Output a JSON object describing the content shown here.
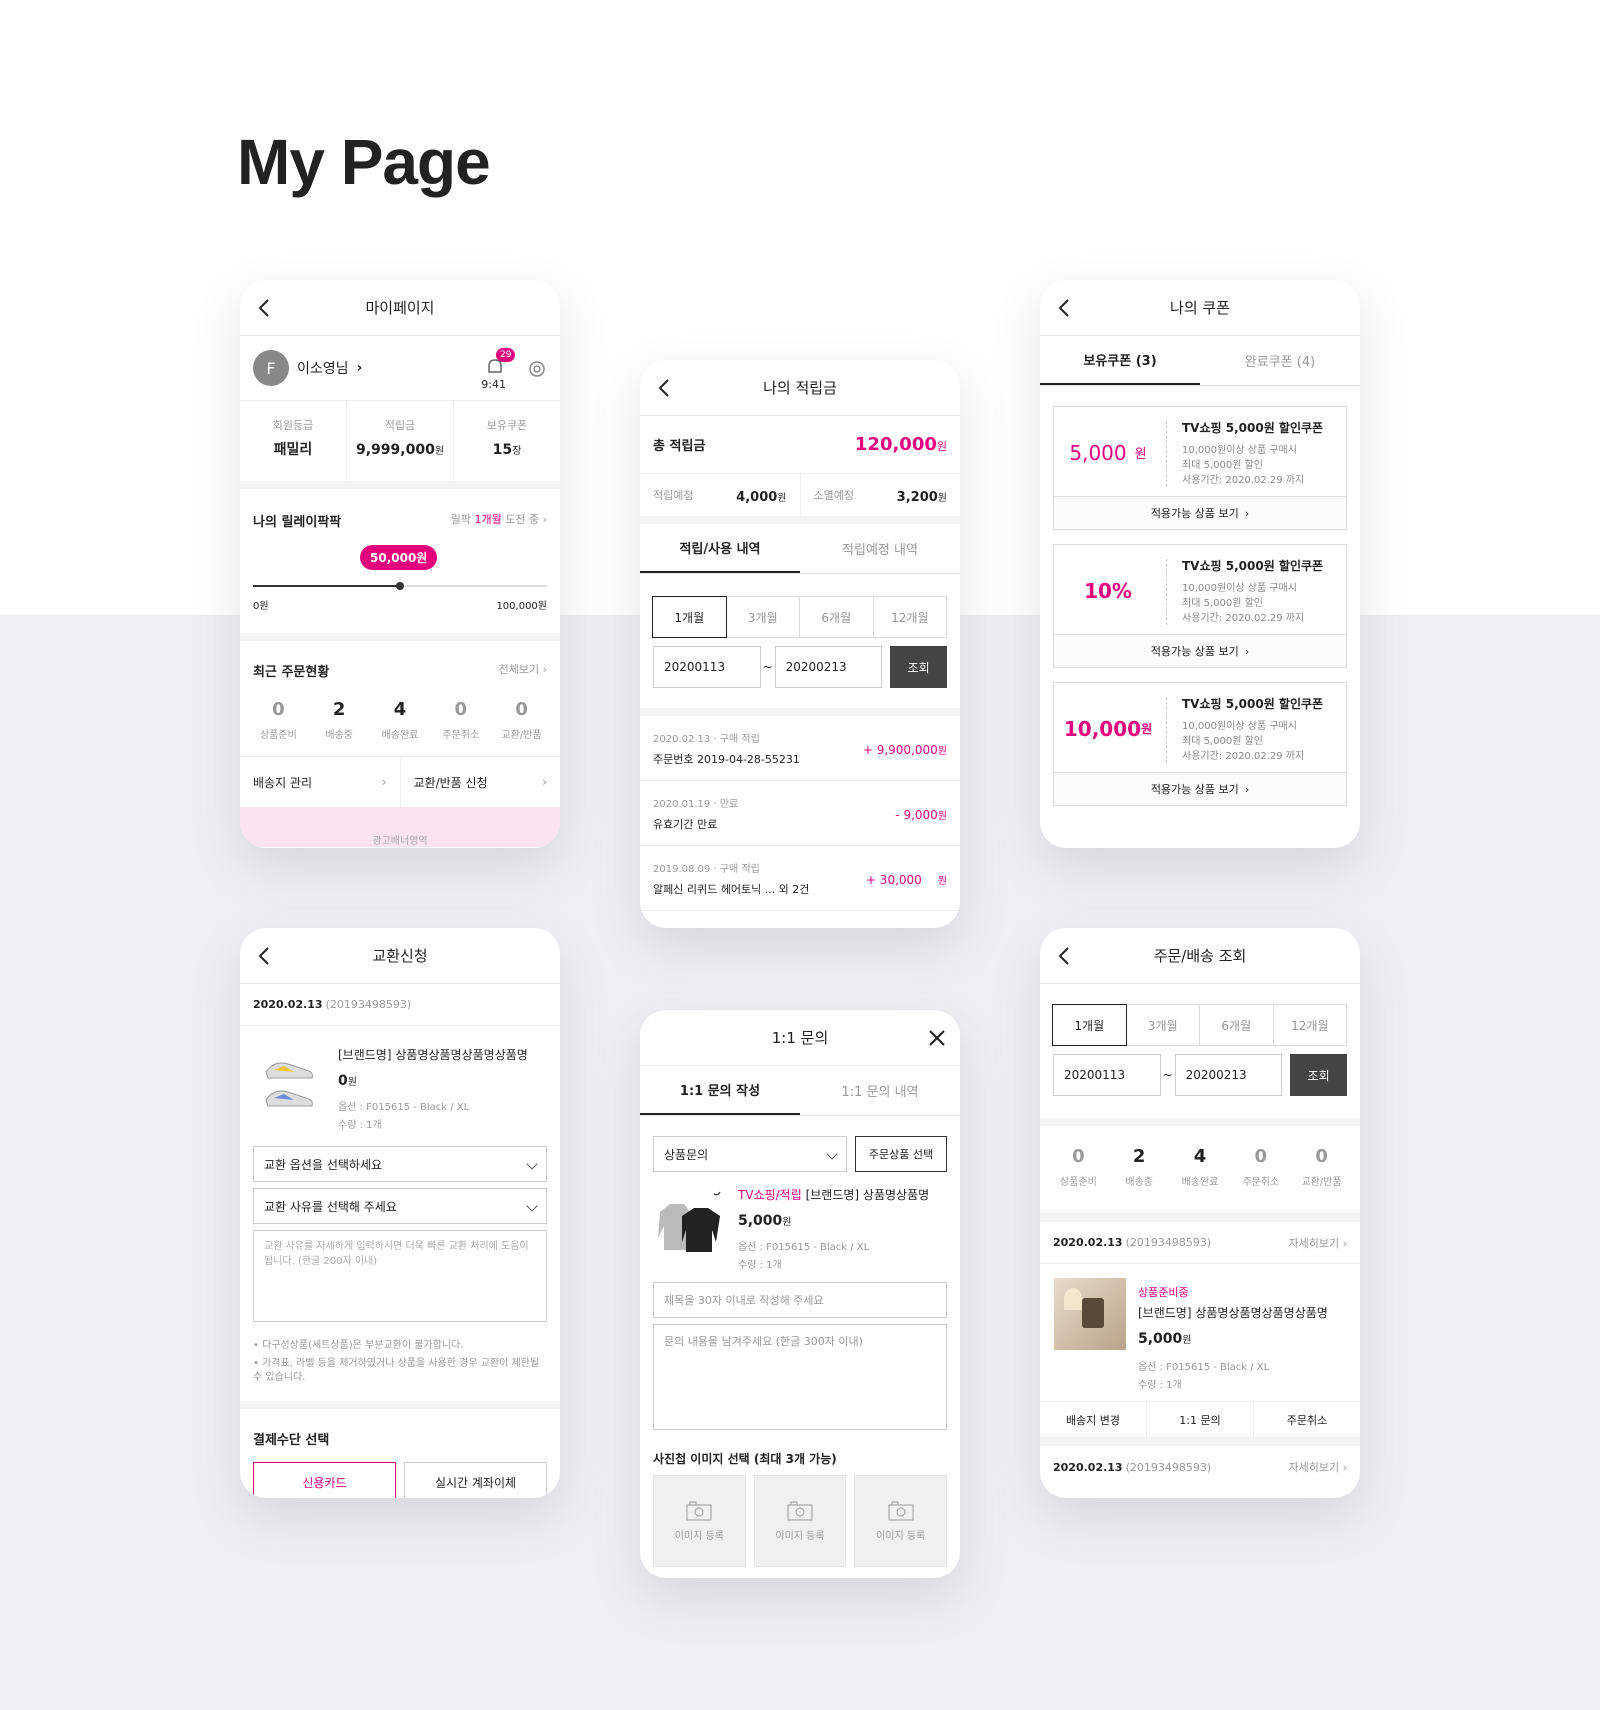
{
  "page_title": "My Page",
  "mypage": {
    "title": "마이페이지",
    "avatar": "F",
    "user": "이소영님",
    "notif_count": "29",
    "time": "9:41",
    "stats": [
      {
        "label": "회원등급",
        "value": "패밀리",
        "unit": ""
      },
      {
        "label": "적립금",
        "value": "9,999,000",
        "unit": "원"
      },
      {
        "label": "보유쿠폰",
        "value": "15",
        "unit": "장"
      }
    ],
    "relay_title": "나의 릴레이팍팍",
    "relay_pre": "릴팍",
    "relay_highlight": "1개월",
    "relay_post": "도전 중",
    "relay_badge": "50,000원",
    "relay_progress": 0.5,
    "relay_min": "0원",
    "relay_max": "100,000원",
    "orders_title": "최근 주문현황",
    "orders_all": "전체보기",
    "orders": [
      {
        "n": "0",
        "l": "상품준비"
      },
      {
        "n": "2",
        "l": "배송중"
      },
      {
        "n": "4",
        "l": "배송완료"
      },
      {
        "n": "0",
        "l": "주문취소"
      },
      {
        "n": "0",
        "l": "교환/반품"
      }
    ],
    "link1": "배송지 관리",
    "link2": "교환/반품 신청",
    "ad": "광고배너영역"
  },
  "points": {
    "title": "나의 적립금",
    "total_label": "총 적립금",
    "total_value": "120,000",
    "total_unit": "원",
    "planned_label": "적립예정",
    "planned_value": "4,000",
    "expire_label": "소멸예정",
    "expire_value": "3,200",
    "unit": "원",
    "tabs": [
      "적립/사용 내역",
      "적립예정 내역"
    ],
    "periods": [
      "1개월",
      "3개월",
      "6개월",
      "12개월"
    ],
    "date_from": "20200113",
    "date_to": "20200213",
    "tilde": "~",
    "query": "조회",
    "history": [
      {
        "meta": "2020.02.13 · 구매 적립",
        "desc": "주문번호 2019-04-28-55231",
        "amount": "+ 9,900,000",
        "unit": "원"
      },
      {
        "meta": "2020.01.19 · 만료",
        "desc": "유효기간 만료",
        "amount": "- 9,000",
        "unit": "원"
      },
      {
        "meta": "2019.08.09 · 구매 적립",
        "desc": "알페신 리퀴드 헤어토닉 ... 외 2건",
        "amount": "+ 30,000",
        "unit": "원"
      }
    ]
  },
  "coupons": {
    "title": "나의 쿠폰",
    "tabs": [
      "보유쿠폰 (3)",
      "완료쿠폰 (4)"
    ],
    "list": [
      {
        "amount": "5,000",
        "unit": "원",
        "title": "TV쇼핑 5,000원 할인쿠폰",
        "d1": "10,000원이상 상품 구매시",
        "d2": "최대 5,000원 할인",
        "d3": "사용기간: 2020.02.29 까지",
        "btn": "적용가능 상품 보기"
      },
      {
        "amount": "10%",
        "unit": "",
        "title": "TV쇼핑 5,000원 할인쿠폰",
        "d1": "10,000원이상 상품 구매시",
        "d2": "최대 5,000원 할인",
        "d3": "사용기간: 2020.02.29 까지",
        "btn": "적용가능 상품 보기"
      },
      {
        "amount": "10,000",
        "unit": "원",
        "title": "TV쇼핑 5,000원 할인쿠폰",
        "d1": "10,000원이상 상품 구매시",
        "d2": "최대 5,000원 할인",
        "d3": "사용기간: 2020.02.29 까지",
        "btn": "적용가능 상품 보기"
      }
    ]
  },
  "exchange": {
    "title": "교환신청",
    "date": "2020.02.13",
    "order_no": "(20193498593)",
    "product": "[브랜드명] 상품명상품명상품명상품명",
    "price": "0",
    "unit": "원",
    "option": "옵션 : F015615 - Black / XL",
    "qty": "수량 : 1개",
    "select1": "교환 옵션을 선택하세요",
    "select2": "교환 사유를 선택해 주세요",
    "textarea_placeholder": "교환 사유를 자세하게 입력하시면 더욱 빠른 교환 처리에 도움이 됩니다. (한글 200자 이내)",
    "note1": "• 다구성상품(세트상품)은 부분교환이 불가합니다.",
    "note2": "• 가격표, 라벨 등을 제거하였거나 상품을 사용한 경우 교환이 제한될 수 있습니다.",
    "pay_title": "결제수단 선택",
    "pay1": "신용카드",
    "pay2": "실시간 계좌이체"
  },
  "inquiry": {
    "title": "1:1 문의",
    "tabs": [
      "1:1 문의 작성",
      "1:1 문의 내역"
    ],
    "category": "상품문의",
    "select_btn": "주문상품 선택",
    "tag": "TV쇼핑/적립",
    "product": "[브랜드명] 상품명상품명",
    "price": "5,000",
    "unit": "원",
    "option": "옵션 : F015615 - Black / XL",
    "qty": "수량 : 1개",
    "subject_placeholder": "제목을 30자 이내로 작성해 주세요",
    "content_placeholder": "문의 내용을 남겨주세요 (한글 300자 이내)",
    "photo_title": "사진첩 이미지 선택 (최대 3개 가능)",
    "photo_btn": "이미지 등록"
  },
  "orders": {
    "title": "주문/배송 조회",
    "periods": [
      "1개월",
      "3개월",
      "6개월",
      "12개월"
    ],
    "date_from": "20200113",
    "date_to": "20200213",
    "tilde": "~",
    "query": "조회",
    "stats": [
      {
        "n": "0",
        "l": "상품준비"
      },
      {
        "n": "2",
        "l": "배송중"
      },
      {
        "n": "4",
        "l": "배송완료"
      },
      {
        "n": "0",
        "l": "주문취소"
      },
      {
        "n": "0",
        "l": "교환/반품"
      }
    ],
    "date1": "2020.02.13",
    "order_no1": "(20193498593)",
    "detail": "자세히보기",
    "status": "상품준비중",
    "product": "[브랜드명] 상품명상품명상품명상품명",
    "price": "5,000",
    "unit": "원",
    "option": "옵션 : F015615 - Black / XL",
    "qty": "수량 : 1개",
    "actions": [
      "배송지 변경",
      "1:1 문의",
      "주문취소"
    ],
    "date2": "2020.02.13",
    "order_no2": "(20193498593)"
  },
  "colors": {
    "accent": "#e6007e",
    "dark_button": "#444444",
    "bg": "#efeff3"
  }
}
